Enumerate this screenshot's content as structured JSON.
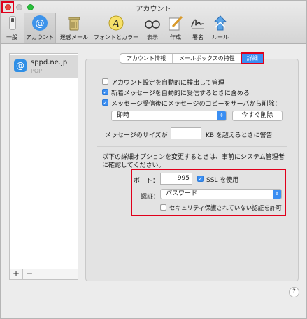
{
  "window": {
    "title": "アカウント"
  },
  "toolbar": {
    "items": [
      {
        "label": "一般"
      },
      {
        "label": "アカウント"
      },
      {
        "label": "迷惑メール"
      },
      {
        "label": "フォントとカラー"
      },
      {
        "label": "表示"
      },
      {
        "label": "作成"
      },
      {
        "label": "署名"
      },
      {
        "label": "ルール"
      }
    ]
  },
  "sidebar": {
    "account": {
      "name": "sppd.ne.jp",
      "type": "POP"
    },
    "add_label": "+",
    "remove_label": "−"
  },
  "tabs": [
    {
      "label": "アカウント情報",
      "selected": false
    },
    {
      "label": "メールボックスの特性",
      "selected": false
    },
    {
      "label": "詳細",
      "selected": true
    }
  ],
  "options": {
    "auto_detect": {
      "label": "アカウント設定を自動的に検出して管理",
      "checked": false
    },
    "include_auto_receive": {
      "label": "新着メッセージを自動的に受信するときに含める",
      "checked": true
    },
    "delete_copy": {
      "label": "メッセージ受信後にメッセージのコピーをサーバから削除：",
      "checked": true
    },
    "delete_timing": "即時",
    "delete_now_button": "今すぐ削除",
    "size_prefix": "メッセージのサイズが",
    "size_value": "",
    "size_suffix": "KB を超えるときに警告"
  },
  "advanced": {
    "note": "以下の詳細オプションを変更するときは、事前にシステム管理者に確認してください。",
    "port_label": "ポート：",
    "port_value": "995",
    "ssl_label": "SSL を使用",
    "ssl_checked": true,
    "auth_label": "認証：",
    "auth_value": "パスワード",
    "insecure_label": "セキュリティ保護されていない認証を許可",
    "insecure_checked": false
  },
  "help_label": "?",
  "colors": {
    "accent": "#3a8ef2",
    "highlight": "#e0001b"
  }
}
